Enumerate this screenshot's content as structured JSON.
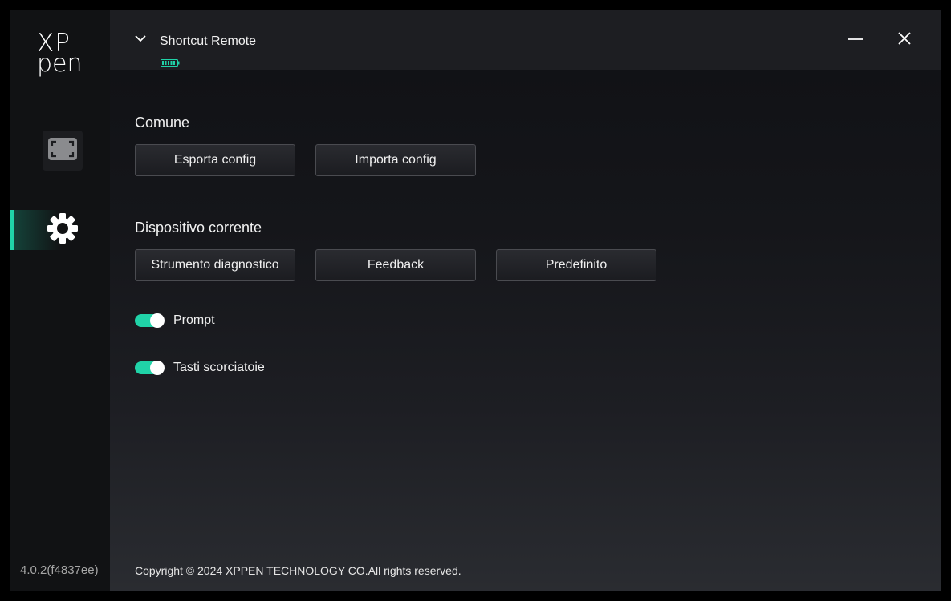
{
  "app": {
    "brand_line1": "XP",
    "brand_line2": "pen",
    "version": "4.0.2(f4837ee)",
    "accent_color": "#20d3a8"
  },
  "sidebar": {
    "items": [
      {
        "name": "screen-mapping",
        "icon": "fullscreen-frame-icon",
        "active": false
      },
      {
        "name": "settings",
        "icon": "gear-icon",
        "active": true
      }
    ]
  },
  "titlebar": {
    "device_name": "Shortcut Remote",
    "dropdown_icon": "chevron-down-icon",
    "battery_icon": "battery-icon",
    "battery_level": 1.0,
    "minimize_icon": "minimize-icon",
    "close_icon": "close-icon"
  },
  "sections": {
    "common": {
      "title": "Comune",
      "export_label": "Esporta config",
      "import_label": "Importa config"
    },
    "device": {
      "title": "Dispositivo corrente",
      "diagnostic_label": "Strumento diagnostico",
      "feedback_label": "Feedback",
      "default_label": "Predefinito"
    }
  },
  "toggles": {
    "prompt": {
      "label": "Prompt",
      "on": true
    },
    "shortcut_keys": {
      "label": "Tasti scorciatoie",
      "on": true
    }
  },
  "footer": {
    "copyright": "Copyright © 2024  XPPEN TECHNOLOGY CO.All rights reserved."
  }
}
